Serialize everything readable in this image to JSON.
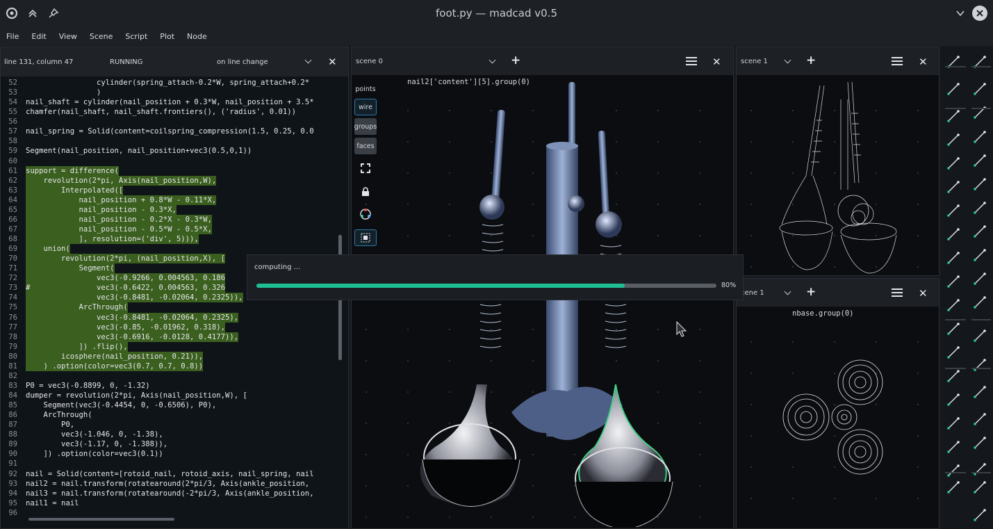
{
  "window": {
    "title": "foot.py — madcad v0.5"
  },
  "menu": [
    "File",
    "Edit",
    "View",
    "Scene",
    "Script",
    "Plot",
    "Node"
  ],
  "editor": {
    "position": "line 131, column 47",
    "status": "RUNNING",
    "mode": "on line change",
    "lines": [
      {
        "n": "52",
        "t": "                cylinder(spring_attach-0.2*W, spring_attach+0.2*",
        "s": false
      },
      {
        "n": "53",
        "t": "                )",
        "s": false
      },
      {
        "n": "54",
        "t": "nail_shaft = cylinder(nail_position + 0.3*W, nail_position + 3.5*",
        "s": false
      },
      {
        "n": "55",
        "t": "chamfer(nail_shaft, nail_shaft.frontiers(), ('radius', 0.01))",
        "s": false
      },
      {
        "n": "56",
        "t": "",
        "s": false
      },
      {
        "n": "57",
        "t": "nail_spring = Solid(content=coilspring_compression(1.5, 0.25, 0.0",
        "s": false
      },
      {
        "n": "58",
        "t": "",
        "s": false
      },
      {
        "n": "59",
        "t": "Segment(nail_position, nail_position+vec3(0.5,0,1))",
        "s": false
      },
      {
        "n": "60",
        "t": "",
        "s": false
      },
      {
        "n": "61",
        "t": "support = difference(",
        "s": true
      },
      {
        "n": "62",
        "t": "    revolution(2*pi, Axis(nail_position,W),",
        "s": true
      },
      {
        "n": "63",
        "t": "        Interpolated([",
        "s": true
      },
      {
        "n": "64",
        "t": "            nail_position + 0.8*W - 0.11*X,",
        "s": true
      },
      {
        "n": "65",
        "t": "            nail_position - 0.3*X,",
        "s": true
      },
      {
        "n": "66",
        "t": "            nail_position - 0.2*X - 0.3*W,",
        "s": true
      },
      {
        "n": "67",
        "t": "            nail_position - 0.5*W - 0.5*X,",
        "s": true
      },
      {
        "n": "68",
        "t": "            ], resolution=('div', 5))),",
        "s": true
      },
      {
        "n": "69",
        "t": "    union(",
        "s": true
      },
      {
        "n": "70",
        "t": "        revolution(2*pi, (nail_position,X), [",
        "s": true
      },
      {
        "n": "71",
        "t": "            Segment(",
        "s": true
      },
      {
        "n": "72",
        "t": "                vec3(-0.9266, 0.004563, 0.186",
        "s": true
      },
      {
        "n": "73",
        "t": "#               vec3(-0.6422, 0.004563, 0.326",
        "s": true
      },
      {
        "n": "74",
        "t": "                vec3(-0.8481, -0.02064, 0.2325)),",
        "s": true
      },
      {
        "n": "75",
        "t": "            ArcThrough(",
        "s": true
      },
      {
        "n": "76",
        "t": "                vec3(-0.8481, -0.02064, 0.2325),",
        "s": true
      },
      {
        "n": "77",
        "t": "                vec3(-0.85, -0.01962, 0.318),",
        "s": true
      },
      {
        "n": "78",
        "t": "                vec3(-0.6916, -0.0128, 0.4177)),",
        "s": true
      },
      {
        "n": "79",
        "t": "            ]) .flip(),",
        "s": true
      },
      {
        "n": "80",
        "t": "        icosphere(nail_position, 0.21)),",
        "s": true
      },
      {
        "n": "81",
        "t": "    ) .option(color=vec3(0.7, 0.7, 0.8))",
        "s": true
      },
      {
        "n": "82",
        "t": "",
        "s": false
      },
      {
        "n": "83",
        "t": "P0 = vec3(-0.8899, 0, -1.32)",
        "s": false
      },
      {
        "n": "84",
        "t": "dumper = revolution(2*pi, Axis(nail_position,W), [",
        "s": false
      },
      {
        "n": "85",
        "t": "    Segment(vec3(-0.4454, 0, -0.6506), P0),",
        "s": false
      },
      {
        "n": "86",
        "t": "    ArcThrough(",
        "s": false
      },
      {
        "n": "87",
        "t": "        P0,",
        "s": false
      },
      {
        "n": "88",
        "t": "        vec3(-1.046, 0, -1.38),",
        "s": false
      },
      {
        "n": "89",
        "t": "        vec3(-1.17, 0, -1.388)),",
        "s": false
      },
      {
        "n": "90",
        "t": "    ]) .option(color=vec3(0.1))",
        "s": false
      },
      {
        "n": "91",
        "t": "",
        "s": false
      },
      {
        "n": "92",
        "t": "nail = Solid(content=[rotoid_nail, rotoid_axis, nail_spring, nail",
        "s": false
      },
      {
        "n": "93",
        "t": "nail2 = nail.transform(rotatearound(2*pi/3, Axis(ankle_position,",
        "s": false
      },
      {
        "n": "94",
        "t": "nail3 = nail.transform(rotatearound(-2*pi/3, Axis(ankle_position,",
        "s": false
      },
      {
        "n": "95",
        "t": "nail1 = nail",
        "s": false
      },
      {
        "n": "96",
        "t": "",
        "s": false
      }
    ]
  },
  "scene0": {
    "name": "scene 0",
    "label": "nail2['content'][5].group(0)",
    "tools": [
      "points",
      "wire",
      "groups",
      "faces"
    ]
  },
  "scene1a": {
    "name": "scene 1"
  },
  "scene1b": {
    "name": "cene 1",
    "label": "nbase.group(0)"
  },
  "progress": {
    "label": "computing ...",
    "value": 80,
    "text": "80%"
  }
}
